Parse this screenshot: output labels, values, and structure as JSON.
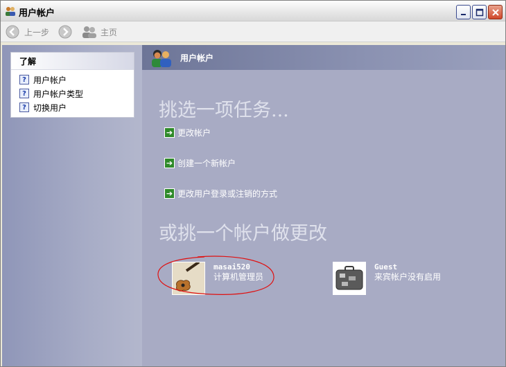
{
  "window": {
    "title": "用户帐户",
    "minimize_label": "_",
    "maximize_label": "□",
    "close_label": "×"
  },
  "nav": {
    "back_label": "上一步",
    "home_label": "主页"
  },
  "learn": {
    "heading": "了解",
    "items": [
      {
        "label": "用户帐户",
        "icon": "help-icon"
      },
      {
        "label": "用户帐户类型",
        "icon": "help-icon"
      },
      {
        "label": "切换用户",
        "icon": "help-icon"
      }
    ]
  },
  "main": {
    "header_title": "用户帐户",
    "pick_task_title": "挑选一项任务...",
    "tasks": [
      {
        "label": "更改帐户",
        "icon": "green-arrow-icon"
      },
      {
        "label": "创建一个新帐户",
        "icon": "green-arrow-icon"
      },
      {
        "label": "更改用户登录或注销的方式",
        "icon": "green-arrow-icon"
      }
    ],
    "pick_account_title": "或挑一个帐户做更改",
    "accounts": [
      {
        "name": "masai520",
        "description": "计算机管理员",
        "picture": "guitar-icon"
      },
      {
        "name": "Guest",
        "description": "来宾帐户没有启用",
        "picture": "suitcase-icon"
      }
    ]
  },
  "colors": {
    "main_bg": "#a8abc4",
    "header_bg": "#7a82a4",
    "task_arrow": "#2f8a2a",
    "annotation": "#e01010"
  }
}
